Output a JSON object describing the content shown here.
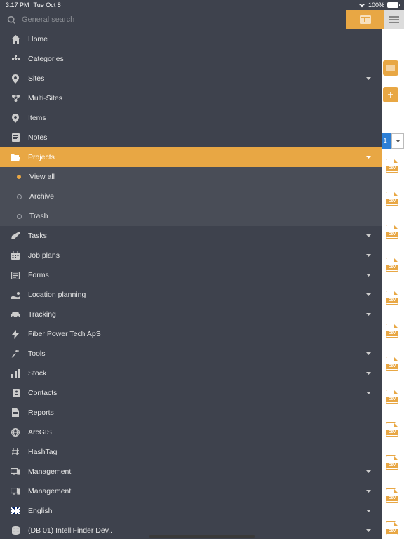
{
  "status": {
    "time": "3:17 PM",
    "date": "Tue Oct 8",
    "battery": "100%"
  },
  "search": {
    "placeholder": "General search"
  },
  "nav": {
    "home": "Home",
    "categories": "Categories",
    "sites": "Sites",
    "multisites": "Multi-Sites",
    "items": "Items",
    "notes": "Notes",
    "projects": "Projects",
    "viewall": "View all",
    "archive": "Archive",
    "trash": "Trash",
    "tasks": "Tasks",
    "jobplans": "Job plans",
    "forms": "Forms",
    "locationplanning": "Location planning",
    "tracking": "Tracking",
    "company": "Fiber Power Tech ApS",
    "tools": "Tools",
    "stock": "Stock",
    "contacts": "Contacts",
    "reports": "Reports",
    "arcgis": "ArcGIS",
    "hashtag": "HashTag",
    "management1": "Management",
    "management2": "Management",
    "language": "English",
    "db": "(DB 01) IntelliFinder Dev.."
  },
  "pager": {
    "current": "1"
  },
  "csv_positions": [
    226,
    273,
    320,
    367,
    414,
    461,
    508,
    555,
    602,
    649,
    696,
    743
  ]
}
